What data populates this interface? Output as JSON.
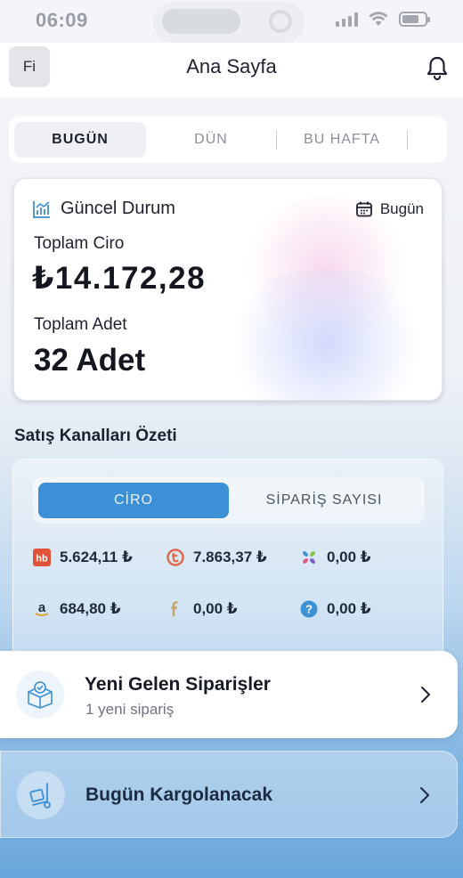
{
  "status_bar": {
    "time": "06:09"
  },
  "header": {
    "avatar_initials": "Fi",
    "title": "Ana Sayfa",
    "bell_icon": "bell-icon"
  },
  "period_tabs": [
    {
      "label": "BUGÜN",
      "active": true
    },
    {
      "label": "DÜN",
      "active": false
    },
    {
      "label": "BU HAFTA",
      "active": false
    }
  ],
  "status_card": {
    "title": "Güncel Durum",
    "date_filter": "Bugün",
    "revenue_label": "Toplam Ciro",
    "revenue_value": "₺14.172,28",
    "quantity_label": "Toplam Adet",
    "quantity_value": "32 Adet"
  },
  "channels": {
    "section_title": "Satış Kanalları Özeti",
    "segments": [
      {
        "label": "CİRO",
        "active": true
      },
      {
        "label": "SİPARİŞ SAYISI",
        "active": false
      }
    ],
    "items": [
      {
        "icon": "hepsiburada-icon",
        "value": "5.624,11 ₺"
      },
      {
        "icon": "trendyol-icon",
        "value": "7.863,37 ₺"
      },
      {
        "icon": "ciceksepeti-icon",
        "value": "0,00 ₺"
      },
      {
        "icon": "amazon-icon",
        "value": "684,80 ₺"
      },
      {
        "icon": "facebook-icon",
        "value": "0,00 ₺"
      },
      {
        "icon": "question-icon",
        "value": "0,00 ₺"
      }
    ]
  },
  "new_orders": {
    "title": "Yeni Gelen Siparişler",
    "subtitle": "1 yeni sipariş"
  },
  "shipping": {
    "title": "Bugün Kargolanacak"
  },
  "colors": {
    "accent": "#3d8fd6",
    "hepsiburada": "#e0533a",
    "trendyol": "#e06a4f",
    "facebook": "#c9a46b",
    "question": "#3f93d4"
  }
}
